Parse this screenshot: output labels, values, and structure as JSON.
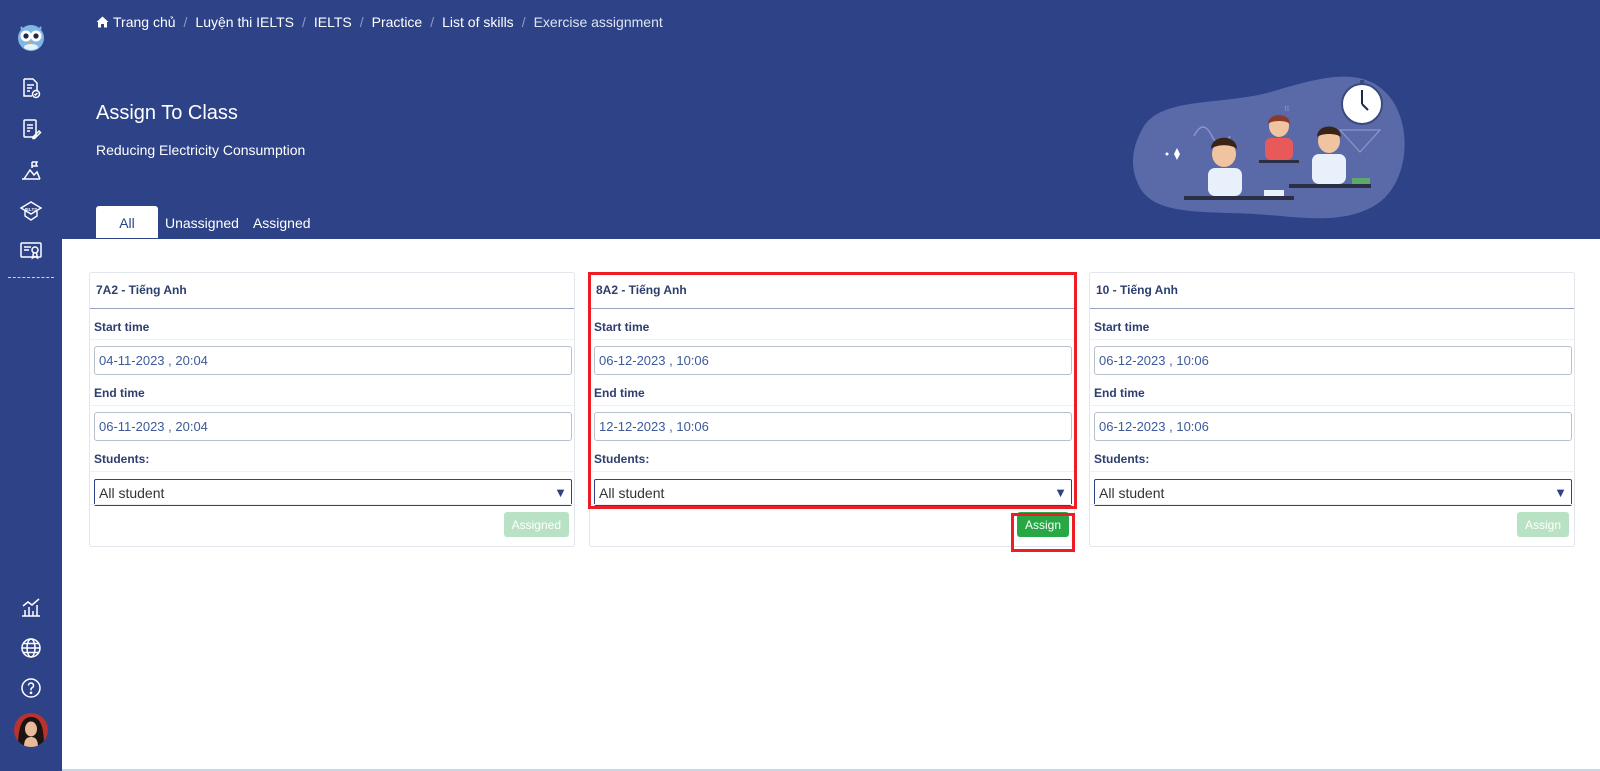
{
  "sidebar": {
    "icons": [
      "owl-logo-icon",
      "document-check-icon",
      "document-edit-icon",
      "chart-mountain-icon",
      "ielts-icon",
      "certificate-icon",
      "analytics-icon",
      "globe-icon",
      "help-icon",
      "user-avatar"
    ],
    "ielts_badge": "IELTS"
  },
  "breadcrumb": {
    "home_icon": "home-icon",
    "items": [
      "Trang chủ",
      "Luyện thi IELTS",
      "IELTS",
      "Practice",
      "List of skills",
      "Exercise assignment"
    ],
    "separator": "/"
  },
  "page": {
    "title": "Assign To Class",
    "subtitle": "Reducing Electricity Consumption"
  },
  "tabs": [
    {
      "label": "All",
      "active": true
    },
    {
      "label": "Unassigned",
      "active": false
    },
    {
      "label": "Assigned",
      "active": false
    }
  ],
  "cards": [
    {
      "title": "7A2 - Tiếng Anh",
      "start_label": "Start time",
      "start_value": "04-11-2023 , 20:04",
      "end_label": "End time",
      "end_value": "06-11-2023 , 20:04",
      "students_label": "Students:",
      "students_value": "All student",
      "button": "Assigned",
      "button_state": "disabled"
    },
    {
      "title": "8A2 - Tiếng Anh",
      "start_label": "Start time",
      "start_value": "06-12-2023 , 10:06",
      "end_label": "End time",
      "end_value": "12-12-2023 , 10:06",
      "students_label": "Students:",
      "students_value": "All student",
      "button": "Assign",
      "button_state": "enabled"
    },
    {
      "title": "10 - Tiếng Anh",
      "start_label": "Start time",
      "start_value": "06-12-2023 , 10:06",
      "end_label": "End time",
      "end_value": "06-12-2023 , 10:06",
      "students_label": "Students:",
      "students_value": "All student",
      "button": "Assign",
      "button_state": "disabled"
    }
  ],
  "colors": {
    "brand": "#2d4287",
    "primary_button": "#28a745",
    "disabled_button": "#b9e2c4",
    "highlight": "#ee1c25"
  }
}
